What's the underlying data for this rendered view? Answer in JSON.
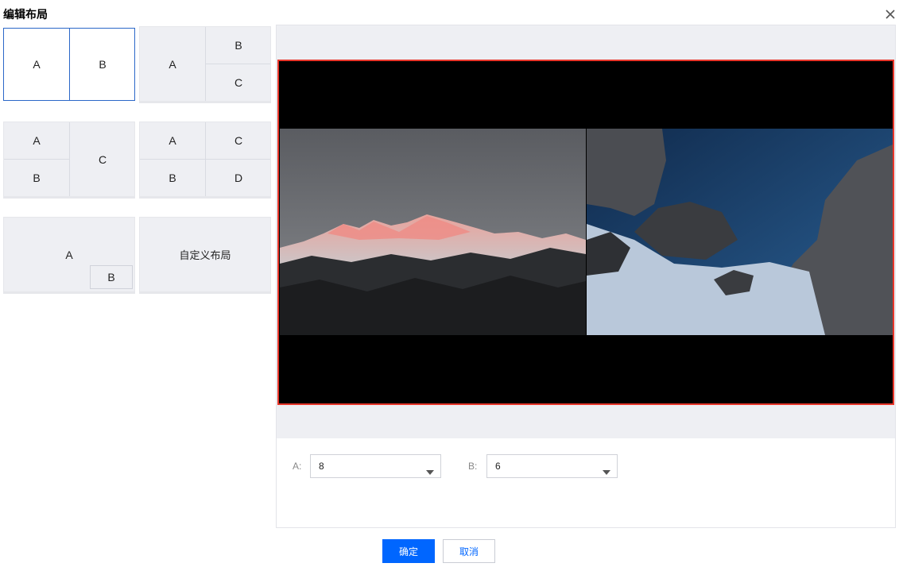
{
  "dialog": {
    "title": "编辑布局"
  },
  "layouts": {
    "two_cols": {
      "a": "A",
      "b": "B"
    },
    "left_right_split": {
      "a": "A",
      "b": "B",
      "c": "C"
    },
    "left_split_right": {
      "a": "A",
      "b": "B",
      "c": "C"
    },
    "grid_four": {
      "a": "A",
      "b": "B",
      "c": "C",
      "d": "D"
    },
    "pip": {
      "a": "A",
      "b": "B"
    },
    "custom": {
      "label": "自定义布局"
    }
  },
  "controls": {
    "a_label": "A:",
    "a_value": "8",
    "b_label": "B:",
    "b_value": "6"
  },
  "buttons": {
    "confirm": "确定",
    "cancel": "取消"
  },
  "colors": {
    "selection": "#2b67c8",
    "preview_border": "#e8362a",
    "primary": "#0066ff"
  }
}
